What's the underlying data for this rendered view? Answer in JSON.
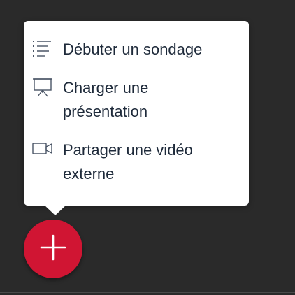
{
  "menu": {
    "items": [
      {
        "icon": "list-icon",
        "label": "Débuter un sondage"
      },
      {
        "icon": "presentation-icon",
        "label": "Charger une présentation"
      },
      {
        "icon": "video-icon",
        "label": "Partager une vidéo externe"
      }
    ]
  },
  "fab": {
    "icon": "plus-icon"
  },
  "colors": {
    "background": "#2a2a2a",
    "menu_bg": "#ffffff",
    "text": "#1e2a3a",
    "icon": "#4a5566",
    "fab": "#d01533"
  }
}
